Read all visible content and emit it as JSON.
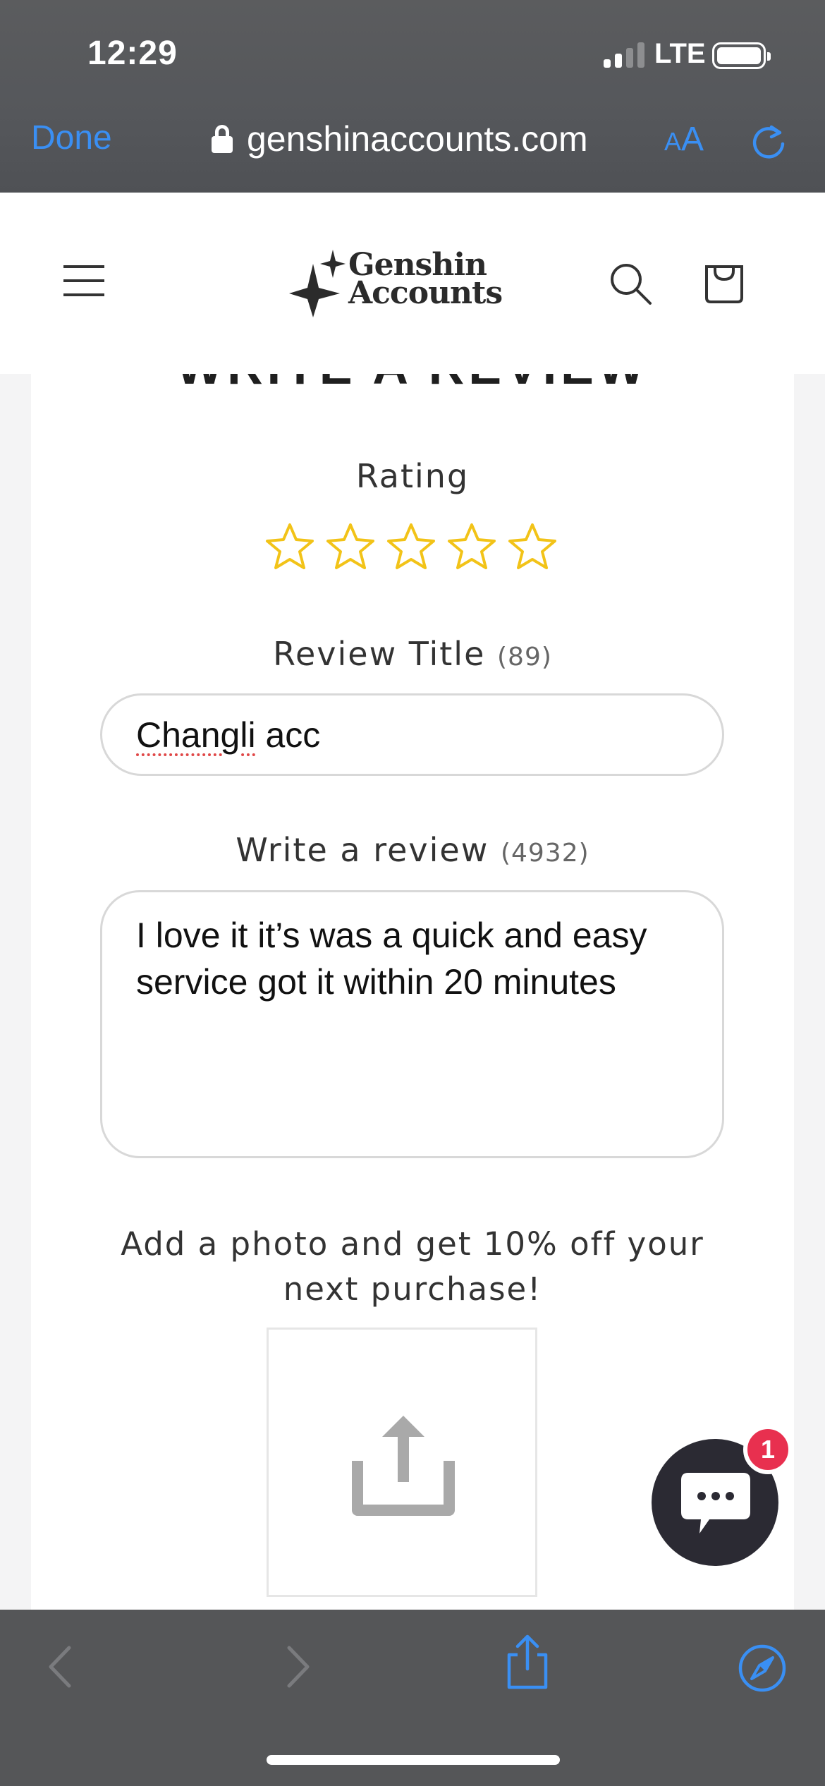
{
  "status_bar": {
    "time": "12:29",
    "network": "LTE"
  },
  "browser": {
    "done_label": "Done",
    "url": "genshinaccounts.com",
    "text_size_small": "A",
    "text_size_big": "A"
  },
  "header": {
    "logo_line1": "Genshin",
    "logo_line2": "Accounts"
  },
  "review_form": {
    "heading": "WRITE A REVIEW",
    "rating_label": "Rating",
    "rating_value": 0,
    "rating_max": 5,
    "title_label": "Review Title",
    "title_count": "(89)",
    "title_value_word1": "Changli",
    "title_value_rest": " acc",
    "review_label": "Write a review",
    "review_count": "(4932)",
    "review_value": "I love it it’s was a quick and easy service got it within 20 minutes",
    "promo_text": "Add a photo and get 10% off your next purchase!"
  },
  "chat": {
    "badge_count": "1"
  },
  "colors": {
    "accent_blue": "#3a8ff3",
    "star_gold": "#f2c318",
    "chat_badge": "#e8304f",
    "chat_bubble": "#2b2a33"
  }
}
